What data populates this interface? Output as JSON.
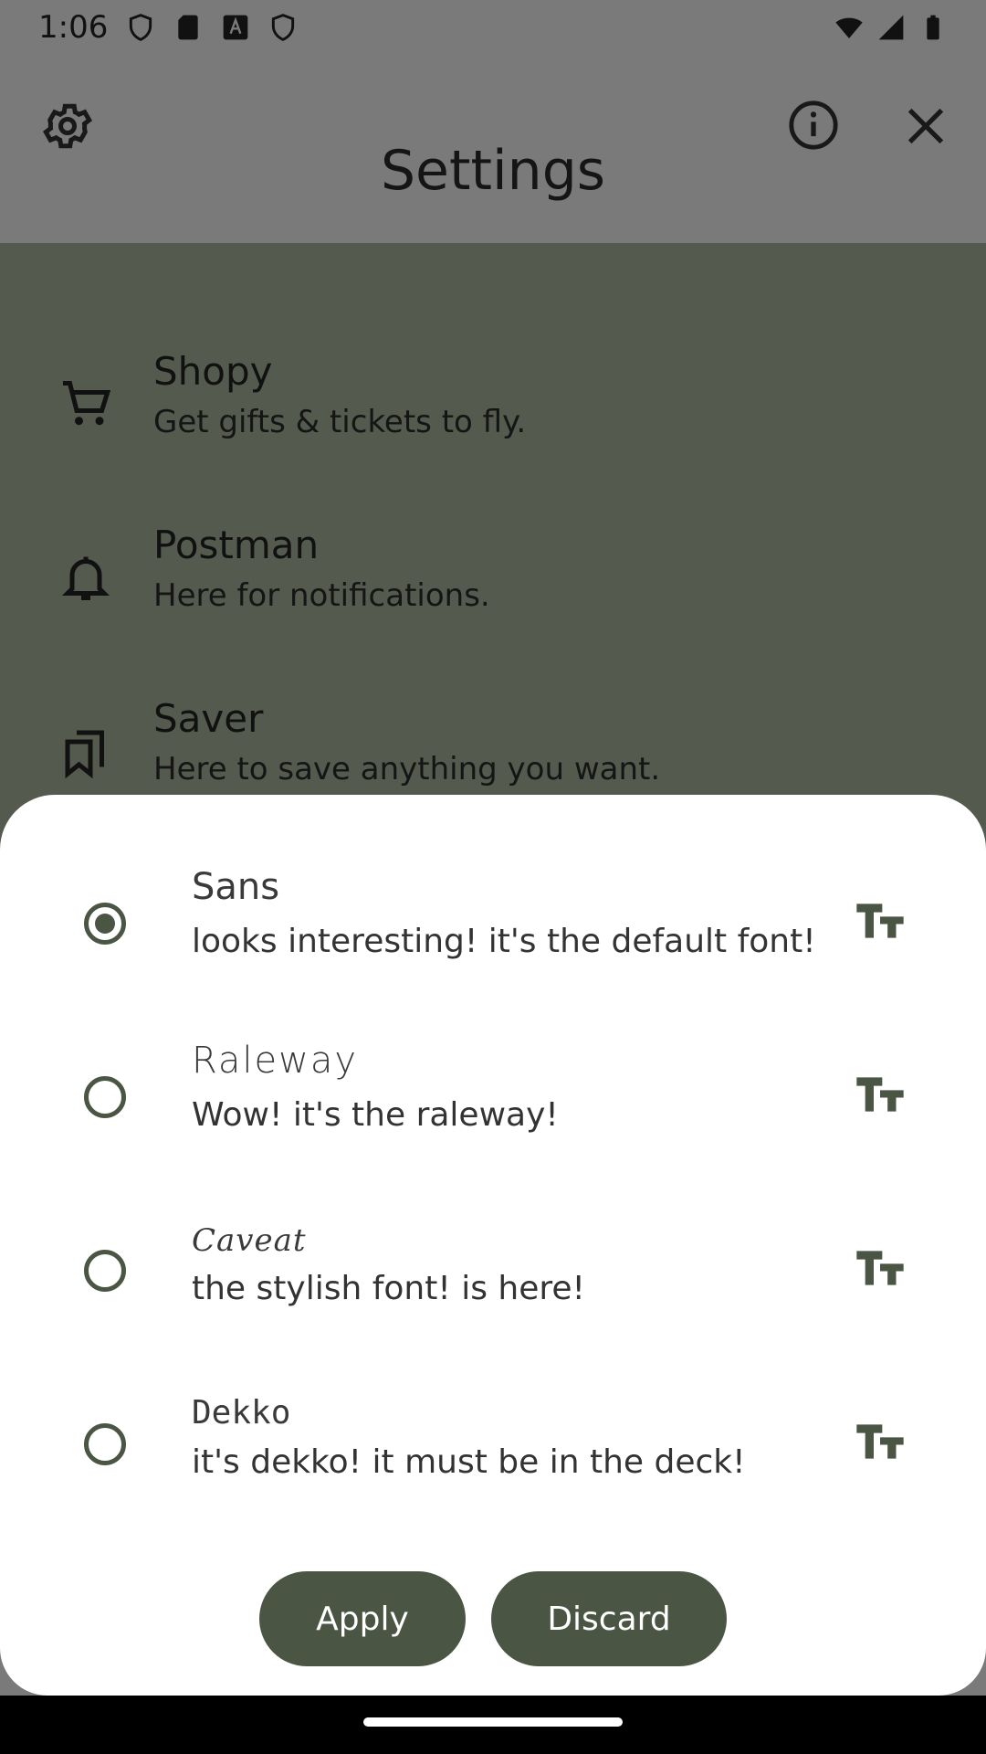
{
  "status_bar": {
    "time": "1:06",
    "icons": [
      "shield-icon",
      "sd-card-icon",
      "font-a-icon",
      "shield-icon",
      "wifi-icon",
      "signal-icon",
      "battery-icon"
    ]
  },
  "app_bar": {
    "title": "Settings",
    "left_icon": "gear-icon",
    "right_icons": [
      "info-icon",
      "close-icon"
    ]
  },
  "list": {
    "items": [
      {
        "icon": "cart-icon",
        "title": "Shopy",
        "subtitle": "Get gifts & tickets to fly."
      },
      {
        "icon": "bell-icon",
        "title": "Postman",
        "subtitle": "Here for notifications."
      },
      {
        "icon": "bookmarks-icon",
        "title": "Saver",
        "subtitle": "Here to save anything you want."
      }
    ]
  },
  "font_sheet": {
    "options": [
      {
        "title": "Sans",
        "subtitle": "looks interesting! it's the default font!",
        "selected": true
      },
      {
        "title": "Raleway",
        "subtitle": "Wow! it's the raleway!",
        "selected": false
      },
      {
        "title": "Caveat",
        "subtitle": "the stylish font! is here!",
        "selected": false
      },
      {
        "title": "Dekko",
        "subtitle": "it's dekko! it must be in the deck!",
        "selected": false
      }
    ],
    "apply_label": "Apply",
    "discard_label": "Discard"
  },
  "colors": {
    "accent": "#4a5643",
    "content_bg": "#a9b49a",
    "sheet_bg": "#ffffff"
  }
}
